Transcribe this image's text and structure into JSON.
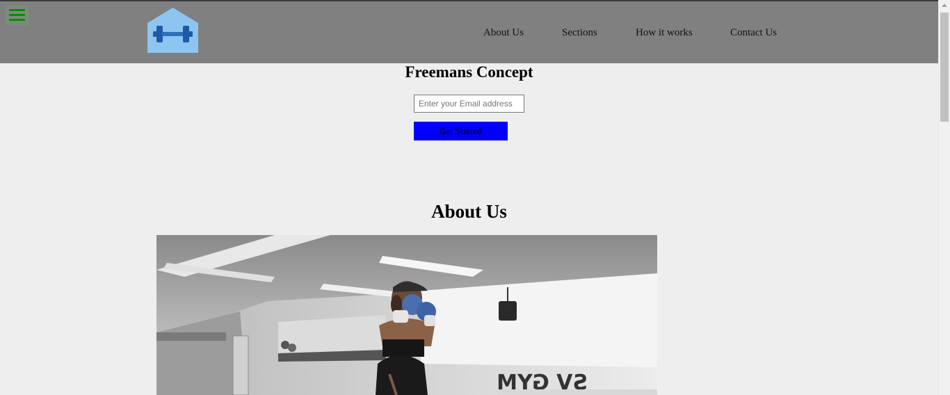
{
  "header": {
    "menu_icon": "hamburger-menu-icon",
    "logo_icon": "dumbbell-house-icon",
    "colors": {
      "background": "#808080",
      "menu_bars": "#0a8a0a",
      "logo_bg": "#8ec5f0",
      "logo_dumbbell": "#1e5aa8"
    },
    "nav": [
      {
        "label": "About Us"
      },
      {
        "label": "Sections"
      },
      {
        "label": "How it works"
      },
      {
        "label": "Contact Us"
      }
    ]
  },
  "hero": {
    "title": "Freemans Concept",
    "email_placeholder": "Enter your Email address",
    "email_value": "",
    "cta_label": "Get Started",
    "cta_color": "#0000ff"
  },
  "about": {
    "title": "About Us",
    "image_icon": "boxer-training-photo"
  },
  "scrollbar": {
    "up_arrow_icon": "scroll-up-arrow-icon"
  }
}
